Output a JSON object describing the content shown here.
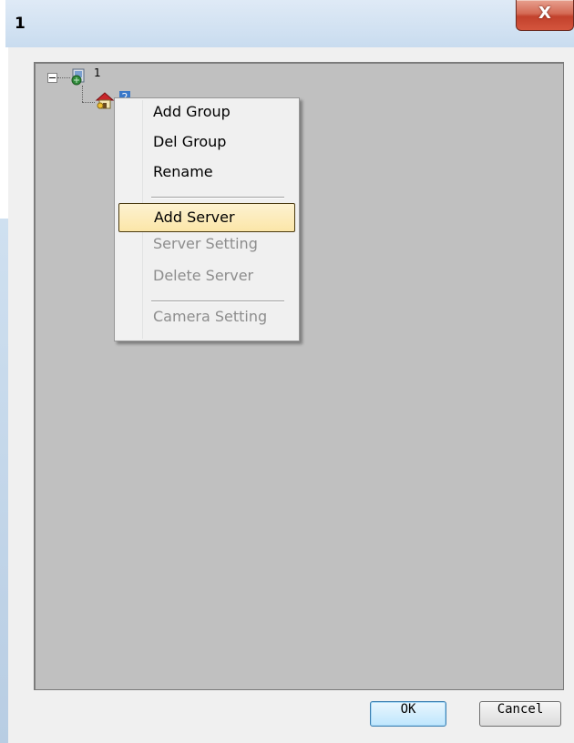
{
  "window": {
    "title": "1",
    "close_glyph": "X"
  },
  "tree": {
    "root": {
      "label": "1",
      "icon": "network-camera-icon"
    },
    "group": {
      "label": "2",
      "icon": "house-group-icon"
    }
  },
  "context_menu": {
    "items": [
      {
        "label": "Add Group",
        "enabled": true,
        "highlighted": false
      },
      {
        "label": "Del Group",
        "enabled": true,
        "highlighted": false
      },
      {
        "label": "Rename",
        "enabled": true,
        "highlighted": false
      },
      {
        "label": "Add Server",
        "enabled": true,
        "highlighted": true
      },
      {
        "label": "Server Setting",
        "enabled": false,
        "highlighted": false
      },
      {
        "label": "Delete Server",
        "enabled": false,
        "highlighted": false
      },
      {
        "label": "Camera Setting",
        "enabled": false,
        "highlighted": false
      }
    ]
  },
  "buttons": {
    "ok": "OK",
    "cancel": "Cancel"
  },
  "colors": {
    "highlight": "#fbe6a8",
    "tree_background": "#c0c0c0",
    "close_red": "#c2412c"
  }
}
